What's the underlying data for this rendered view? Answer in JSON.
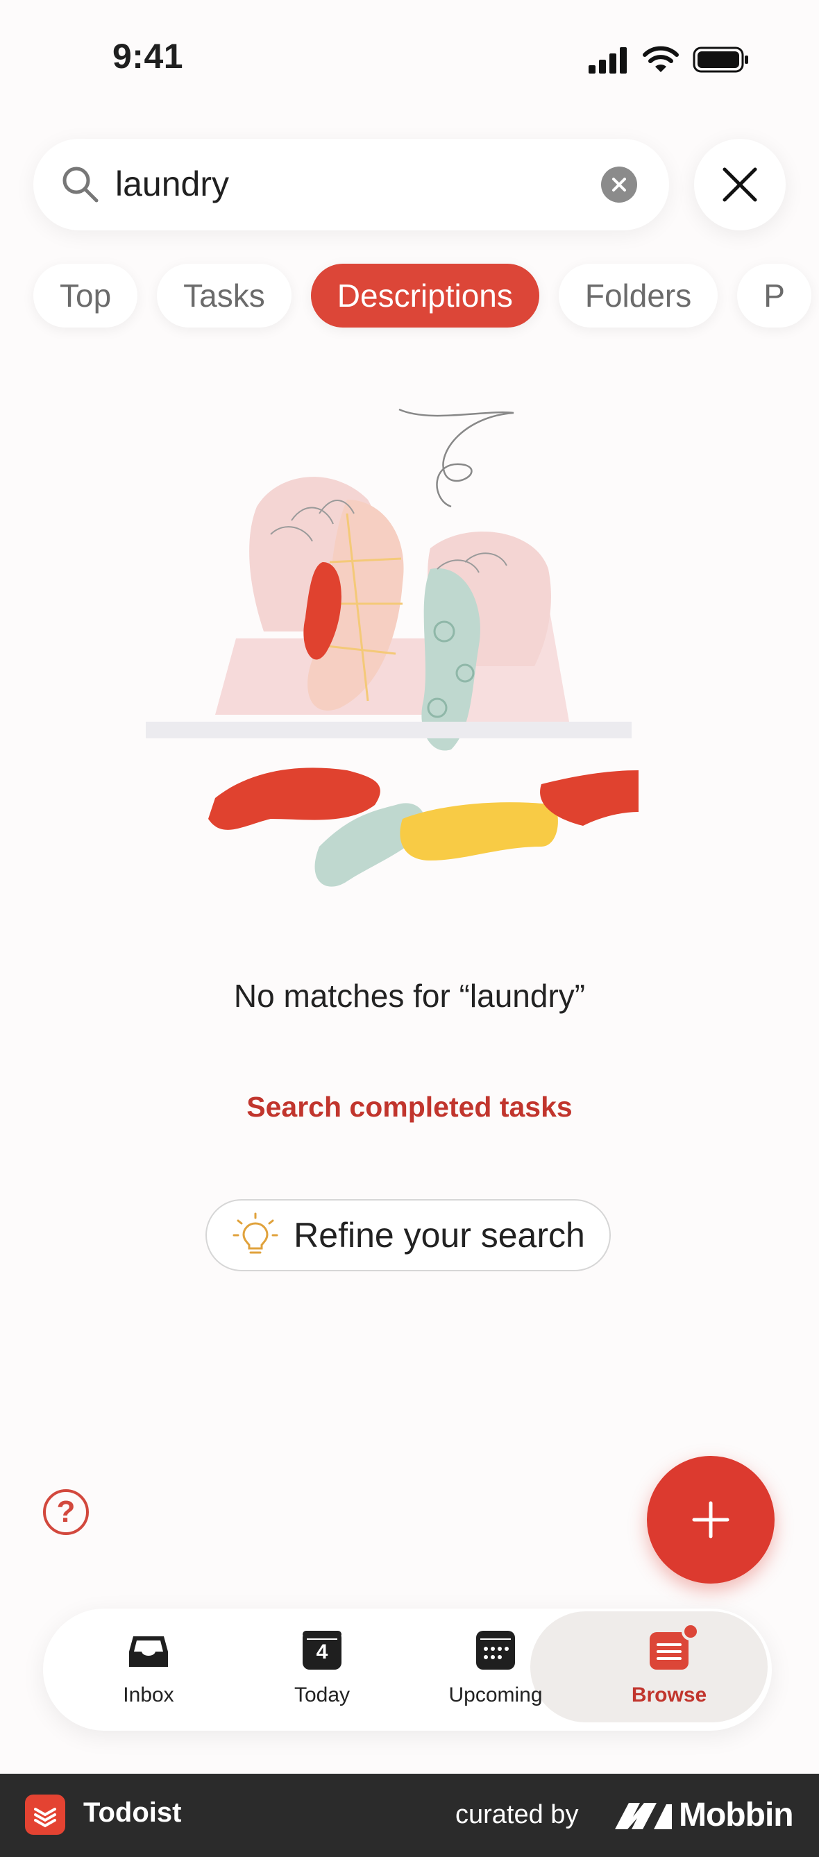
{
  "status_bar": {
    "time": "9:41"
  },
  "search": {
    "query": "laundry"
  },
  "filter_tabs": [
    {
      "label": "Top",
      "active": false
    },
    {
      "label": "Tasks",
      "active": false
    },
    {
      "label": "Descriptions",
      "active": true
    },
    {
      "label": "Folders",
      "active": false
    },
    {
      "label": "P",
      "active": false
    }
  ],
  "empty_state": {
    "title": "No matches for “laundry”",
    "search_completed_label": "Search completed tasks",
    "refine_label": "Refine your search"
  },
  "tab_bar": {
    "items": [
      {
        "label": "Inbox",
        "icon": "inbox-icon"
      },
      {
        "label": "Today",
        "icon": "calendar-today-icon",
        "badge": "4"
      },
      {
        "label": "Upcoming",
        "icon": "calendar-upcoming-icon"
      },
      {
        "label": "Browse",
        "icon": "browse-icon",
        "active": true,
        "has_notification_dot": true
      }
    ]
  },
  "footer": {
    "app_name": "Todoist",
    "curated_by": "curated by",
    "brand": "Mobbin"
  },
  "colors": {
    "accent": "#dc4638",
    "accent_dark": "#c1352d",
    "background": "#fdfbfb",
    "footer_bg": "#2b2b2b"
  }
}
